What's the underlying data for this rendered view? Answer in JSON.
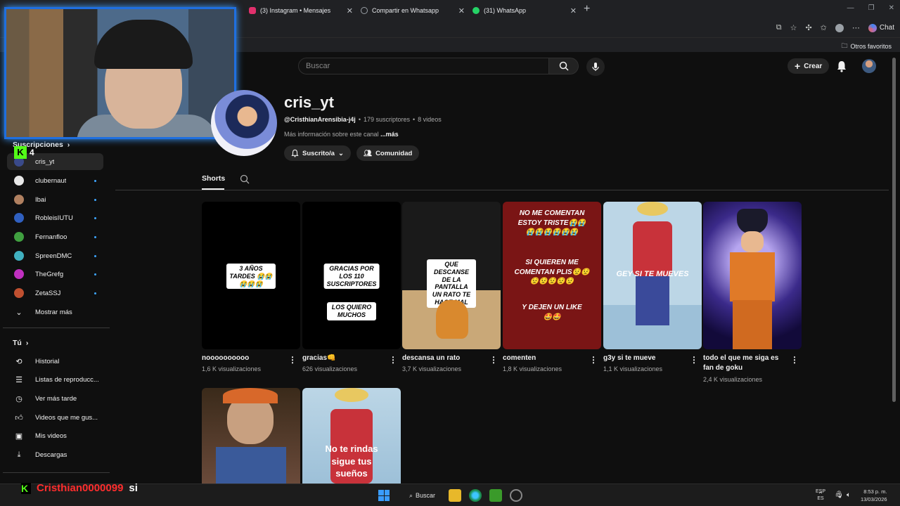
{
  "browser": {
    "tabs": [
      {
        "label": "(3) Instagram • Mensajes",
        "color": "#e1306c"
      },
      {
        "label": "Compartir en Whatsapp",
        "color": "#9aa0a6"
      },
      {
        "label": "(31) WhatsApp",
        "color": "#25d366"
      }
    ],
    "close_glyph": "✕",
    "new_tab_glyph": "+",
    "chat_label": "Chat",
    "bookmark_folder": "Otros favoritos"
  },
  "header": {
    "search_placeholder": "Buscar",
    "create_label": "Crear"
  },
  "sidebar": {
    "subscriptions_heading": "Suscripciones",
    "channels": [
      {
        "name": "cris_yt",
        "color": "#3a4a8a",
        "active": true,
        "dot": false
      },
      {
        "name": "clubernaut",
        "color": "#e8e8e8",
        "active": false,
        "dot": true
      },
      {
        "name": "Ibai",
        "color": "#b08060",
        "active": false,
        "dot": true
      },
      {
        "name": "RobleisIUTU",
        "color": "#3060c0",
        "active": false,
        "dot": true
      },
      {
        "name": "Fernanfloo",
        "color": "#40a040",
        "active": false,
        "dot": true
      },
      {
        "name": "SpreenDMC",
        "color": "#40b0c0",
        "active": false,
        "dot": true
      },
      {
        "name": "TheGrefg",
        "color": "#c030c0",
        "active": false,
        "dot": true
      },
      {
        "name": "ZetaSSJ",
        "color": "#c05030",
        "active": false,
        "dot": true
      }
    ],
    "show_more": "Mostrar más",
    "you_heading": "Tú",
    "you_items": [
      {
        "label": "Historial",
        "icon": "history-icon"
      },
      {
        "label": "Listas de reproducc...",
        "icon": "playlists-icon"
      },
      {
        "label": "Ver más tarde",
        "icon": "watch-later-icon"
      },
      {
        "label": "Videos que me gus...",
        "icon": "liked-icon"
      },
      {
        "label": "Mis videos",
        "icon": "my-videos-icon"
      },
      {
        "label": "Descargas",
        "icon": "downloads-icon"
      }
    ]
  },
  "stream_overlay": {
    "kick_count": "4",
    "chat_user": "Cristhian0000099",
    "chat_message": "si"
  },
  "channel": {
    "name": "cris_yt",
    "handle": "@CristhianArensibia-j4j",
    "subscribers": "179 suscriptores",
    "videos": "8 videos",
    "separator": "•",
    "description": "Más información sobre este canal",
    "more_link": "...más",
    "subscribed_label": "Suscrito/a",
    "community_label": "Comunidad",
    "tab_shorts": "Shorts"
  },
  "shorts": [
    {
      "title": "noooooooooo",
      "views": "1,6 K visualizaciones",
      "captions": [
        "3 AÑOS TARDES 😭😭",
        "😭😭😭"
      ]
    },
    {
      "title": "gracias👊",
      "views": "626 visualizaciones",
      "captions": [
        "GRACIAS POR LOS 110",
        "SUSCRIPTORES",
        "LOS QUIERO MUCHOS"
      ]
    },
    {
      "title": "descansa un rato",
      "views": "3,7 K visualizaciones",
      "captions": [
        "QUE DESCANSE DE LA",
        "PANTALLA UN RATO TE",
        "HACE MAL"
      ]
    },
    {
      "title": "comenten",
      "views": "1,8 K visualizaciones",
      "captions": [
        "NO ME COMENTAN",
        "ESTOY TRISTE😭😭",
        "😭😭😭😭😭😭",
        "SI QUIEREN ME",
        "COMENTAN PLIS😟😟",
        "😟😟😟😟😟",
        "Y DEJEN UN LIKE",
        "🤩🤩"
      ]
    },
    {
      "title": "g3y si te mueve",
      "views": "1,1 K visualizaciones",
      "captions": [
        "GEY SI TE MUEVES"
      ]
    },
    {
      "title": "todo el que me siga es fan de goku",
      "views": "2,4 K visualizaciones",
      "captions": []
    },
    {
      "title": "",
      "views": "",
      "captions": []
    },
    {
      "title": "",
      "views": "",
      "captions": [
        "No te rindas",
        "sigue tus",
        "sueños"
      ]
    }
  ],
  "taskbar": {
    "search_label": "Buscar",
    "lang_1": "ESP",
    "lang_2": "ES",
    "time": "8:53 p. m.",
    "date": "13/03/2026"
  }
}
